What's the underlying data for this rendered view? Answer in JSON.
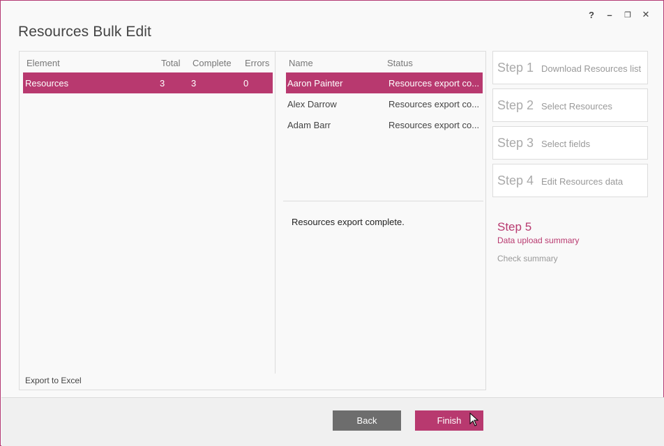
{
  "window": {
    "title": "Resources Bulk Edit",
    "controls": {
      "help": "?",
      "minimize": "–",
      "restore": "❐",
      "close": "✕"
    }
  },
  "left_grid": {
    "columns": [
      "Element",
      "Total",
      "Complete",
      "Errors"
    ],
    "rows": [
      {
        "element": "Resources",
        "total": "3",
        "complete": "3",
        "errors": "0",
        "selected": true
      }
    ],
    "export_label": "Export to Excel"
  },
  "right_grid": {
    "columns": [
      "Name",
      "Status"
    ],
    "rows": [
      {
        "name": "Aaron Painter",
        "status": "Resources export co...",
        "selected": true
      },
      {
        "name": "Alex Darrow",
        "status": "Resources export co..."
      },
      {
        "name": "Adam Barr",
        "status": "Resources export co..."
      }
    ],
    "detail_message": "Resources export complete."
  },
  "steps": [
    {
      "num": "Step 1",
      "label": "Download Resources list"
    },
    {
      "num": "Step 2",
      "label": "Select Resources"
    },
    {
      "num": "Step 3",
      "label": "Select fields"
    },
    {
      "num": "Step 4",
      "label": "Edit Resources data"
    }
  ],
  "active_step": {
    "num": "Step 5",
    "label": "Data upload summary",
    "sub": "Check summary"
  },
  "footer": {
    "back_label": "Back",
    "finish_label": "Finish"
  },
  "colors": {
    "accent": "#b8396f",
    "back_button": "#6d6d6d"
  }
}
